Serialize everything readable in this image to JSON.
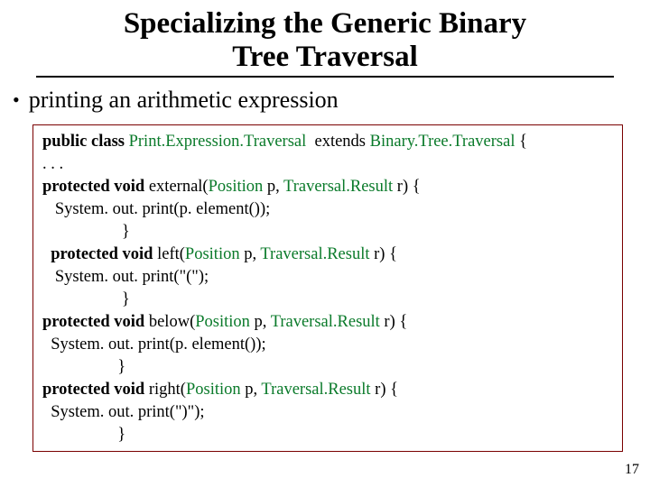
{
  "title_line1": "Specializing the Generic Binary",
  "title_line2": "Tree Traversal",
  "bullet_text": "printing an arithmetic expression",
  "code": {
    "l1": {
      "kw": "public class ",
      "typ": "Print.Expression.Traversal",
      "mid": "  extends ",
      "typ2": "Binary.Tree.Traversal",
      "end": " {"
    },
    "l2": ". . .",
    "l3": {
      "kw": "protected void ",
      "name": "external",
      "sig_open": "(",
      "typ1": "Position",
      "p1": " p,",
      "typ2": " Traversal.Result",
      "p2": " r",
      "sig_close": ") {"
    },
    "l4": "   System. out. print(p. element());",
    "l5": "                   }",
    "l6": {
      "indent": "  ",
      "kw": "protected void ",
      "name": "left",
      "sig_open": "(",
      "typ1": "Position",
      "p1": " p,",
      "typ2": " Traversal.Result",
      "p2": " r",
      "sig_close": ") {"
    },
    "l7": "   System. out. print(\"(\");",
    "l8": "                   }",
    "l9": {
      "kw": "protected void ",
      "name": "below",
      "sig_open": "(",
      "typ1": "Position",
      "p1": " p,",
      "typ2": " Traversal.Result",
      "p2": " r",
      "sig_close": ") {"
    },
    "l10": "  System. out. print(p. element());",
    "l11": "                  }",
    "l12": {
      "kw": "protected void ",
      "name": "right",
      "sig_open": "(",
      "typ1": "Position",
      "p1": " p,",
      "typ2": " Traversal.Result",
      "p2": " r",
      "sig_close": ") {"
    },
    "l13": "  System. out. print(\")\");",
    "l14": "                  }"
  },
  "page_number": "17"
}
